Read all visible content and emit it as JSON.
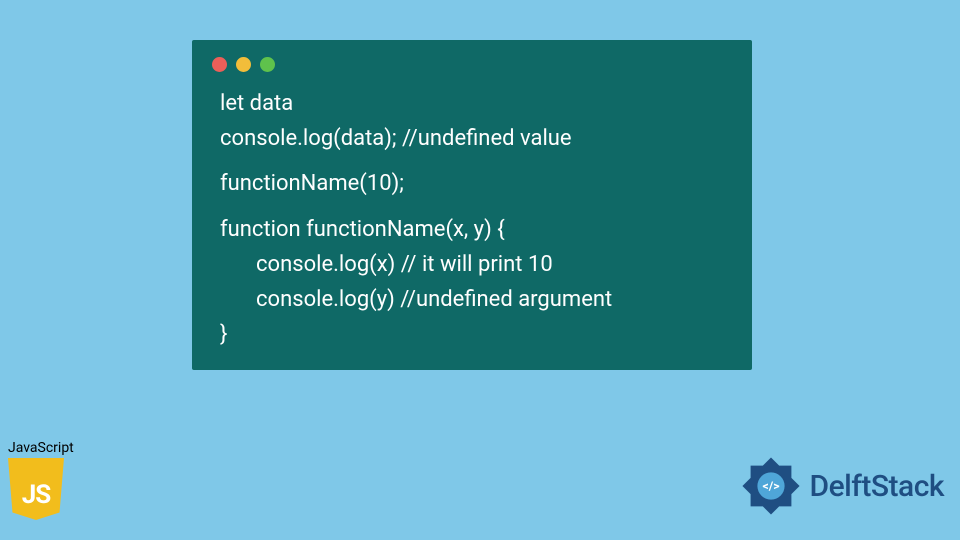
{
  "code": {
    "lines": [
      "let data",
      "console.log(data); //undefined value",
      "functionName(10);",
      "function functionName(x, y) {",
      "console.log(x) // it will print 10",
      "console.log(y) //undefined argument",
      "}"
    ]
  },
  "jsBadge": {
    "label": "JavaScript",
    "logoText": "JS"
  },
  "brand": {
    "name": "DelftStack"
  },
  "colors": {
    "background": "#7fc8e8",
    "codeBg": "#0f6966",
    "codeText": "#fefefe",
    "jsYellow": "#f2bd1c",
    "brandBlue": "#1f4e82"
  }
}
